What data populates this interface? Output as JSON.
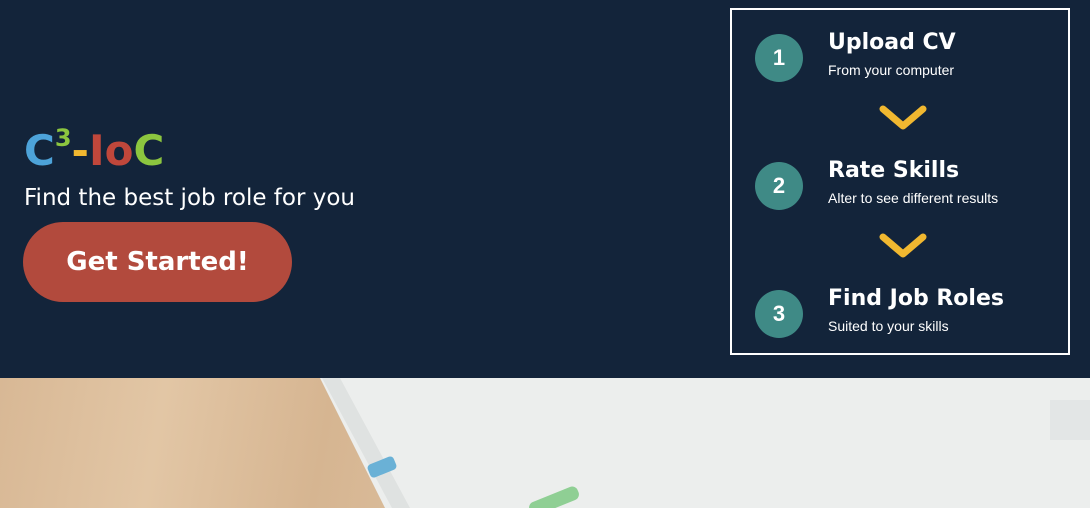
{
  "hero": {
    "logo": {
      "c1": "C",
      "sup": "3",
      "dash": "-",
      "io": "Io",
      "c2": "C"
    },
    "tagline": "Find the best job role for you",
    "cta_label": "Get Started!"
  },
  "steps": [
    {
      "number": "1",
      "title": "Upload CV",
      "subtitle": "From your computer"
    },
    {
      "number": "2",
      "title": "Rate Skills",
      "subtitle": "Alter to see different results"
    },
    {
      "number": "3",
      "title": "Find Job Roles",
      "subtitle": "Suited to your skills"
    }
  ],
  "colors": {
    "background": "#13243a",
    "cta": "#b24a3d",
    "step_circle": "#3f8a86",
    "chevron": "#f1b830"
  },
  "icons": [
    "chevron-down-icon"
  ]
}
